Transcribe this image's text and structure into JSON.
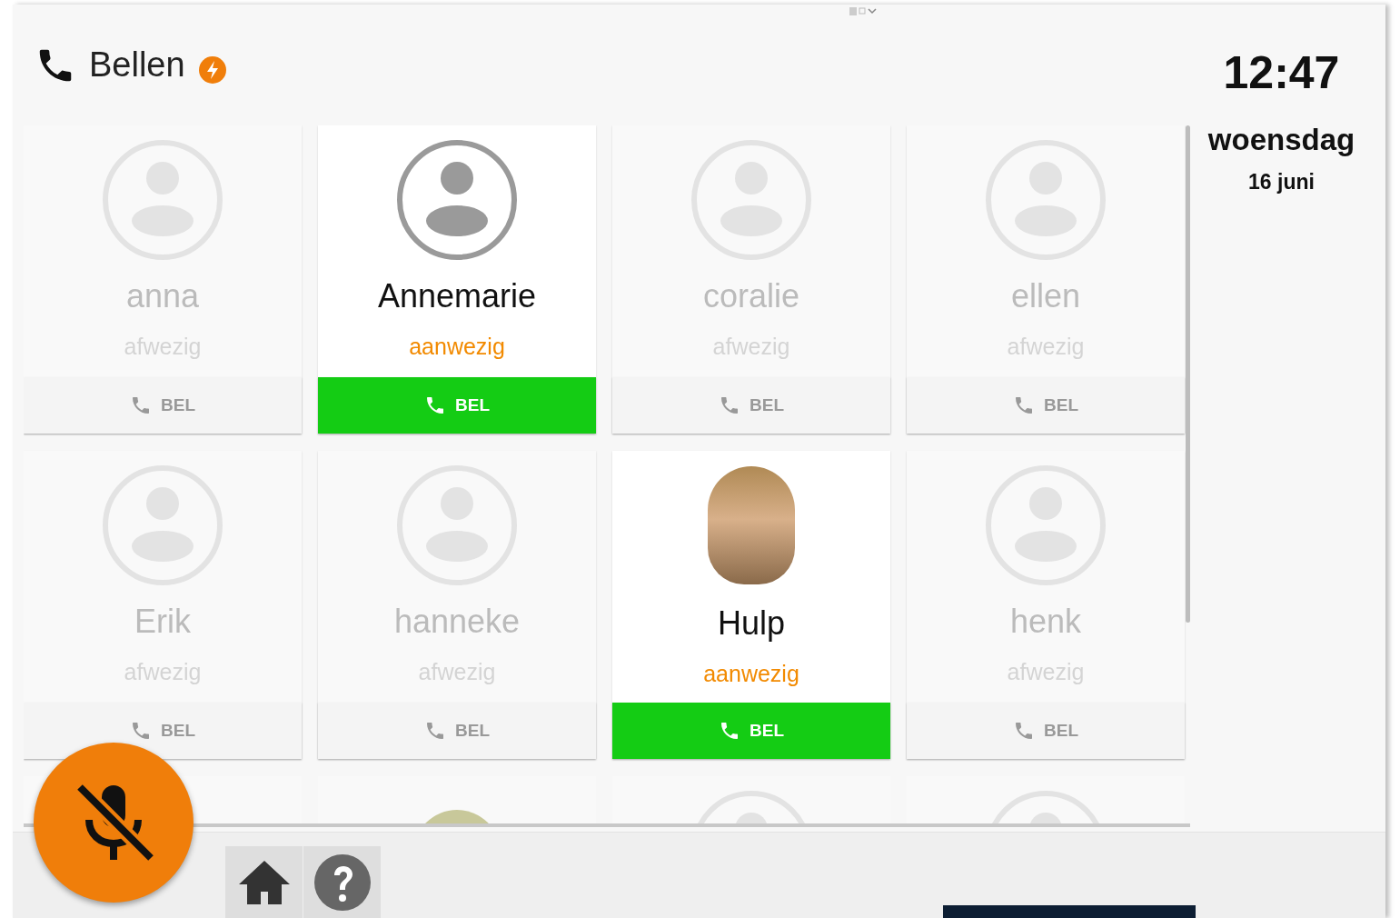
{
  "header": {
    "title": "Bellen"
  },
  "clock": {
    "time": "12:47",
    "weekday": "woensdag",
    "date": "16 juni"
  },
  "contacts": [
    {
      "name": "anna",
      "status": "afwezig",
      "present": false,
      "kind": "placeholder",
      "call_label": "BEL"
    },
    {
      "name": "Annemarie",
      "status": "aanwezig",
      "present": true,
      "kind": "placeholder",
      "call_label": "BEL"
    },
    {
      "name": "coralie",
      "status": "afwezig",
      "present": false,
      "kind": "placeholder",
      "call_label": "BEL"
    },
    {
      "name": "ellen",
      "status": "afwezig",
      "present": false,
      "kind": "placeholder",
      "call_label": "BEL"
    },
    {
      "name": "Erik",
      "status": "afwezig",
      "present": false,
      "kind": "placeholder",
      "call_label": "BEL"
    },
    {
      "name": "hanneke",
      "status": "afwezig",
      "present": false,
      "kind": "placeholder",
      "call_label": "BEL"
    },
    {
      "name": "Hulp",
      "status": "aanwezig",
      "present": true,
      "kind": "photo",
      "call_label": "BEL"
    },
    {
      "name": "henk",
      "status": "afwezig",
      "present": false,
      "kind": "placeholder",
      "call_label": "BEL"
    }
  ],
  "partial_row": [
    {
      "kind": "blank"
    },
    {
      "kind": "photo"
    },
    {
      "kind": "placeholder"
    },
    {
      "kind": "placeholder"
    }
  ],
  "mic": {
    "muted": true
  }
}
